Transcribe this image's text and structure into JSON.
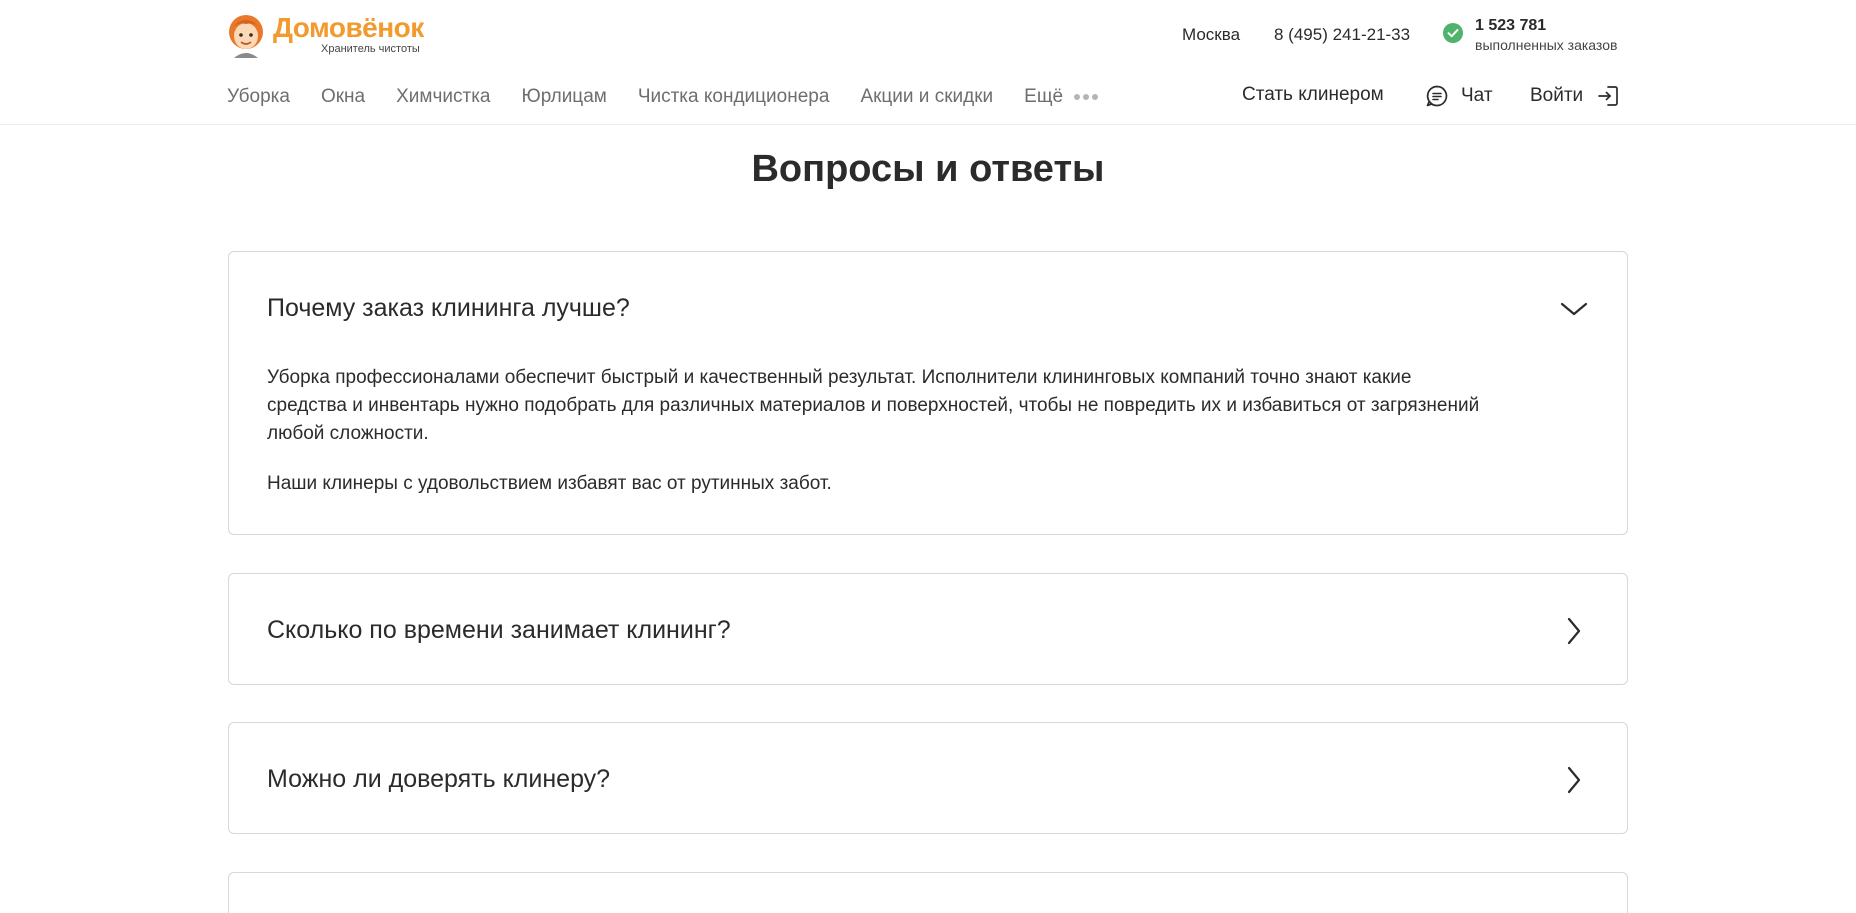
{
  "brand": {
    "name": "Домовёнок",
    "tagline": "Хранитель чистоты",
    "accent_color": "#f29a2e"
  },
  "topbar": {
    "city": "Москва",
    "phone": "8 (495) 241-21-33",
    "orders_count": "1 523 781",
    "orders_label": "выполненных заказов",
    "check_color": "#4fb36b"
  },
  "nav": {
    "items": [
      "Уборка",
      "Окна",
      "Химчистка",
      "Юрлицам",
      "Чистка кондиционера",
      "Акции и скидки"
    ],
    "more_label": "Ещё",
    "become_cleaner": "Стать клинером",
    "chat_label": "Чат",
    "login_label": "Войти"
  },
  "page": {
    "title": "Вопросы и ответы"
  },
  "faq": [
    {
      "question": "Почему заказ клининга лучше?",
      "expanded": true,
      "answer_lines": [
        "Уборка профессионалами обеспечит быстрый и качественный результат. Исполнители клининговых компаний точно знают какие",
        "средства и инвентарь нужно подобрать для различных материалов и поверхностей, чтобы не повредить их и избавиться от загрязнений",
        "любой сложности."
      ],
      "answer_extra": "Наши клинеры с удовольствием избавят вас от рутинных забот."
    },
    {
      "question": "Сколько по времени занимает клининг?",
      "expanded": false
    },
    {
      "question": "Можно ли доверять клинеру?",
      "expanded": false
    }
  ]
}
